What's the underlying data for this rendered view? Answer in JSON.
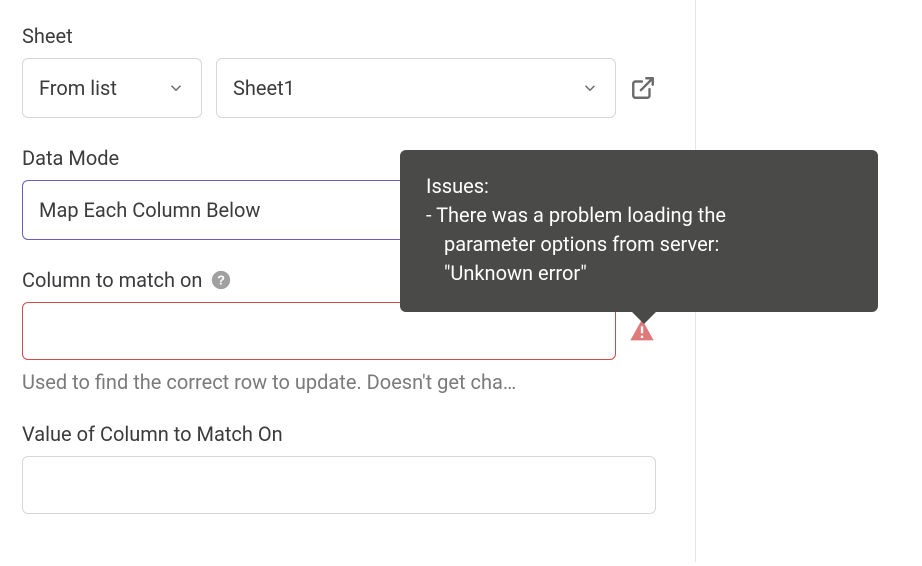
{
  "sheet": {
    "label": "Sheet",
    "source_select_value": "From list",
    "sheet_select_value": "Sheet1"
  },
  "data_mode": {
    "label": "Data Mode",
    "value": "Map Each Column Below"
  },
  "column_match": {
    "label": "Column to match on",
    "value": "",
    "helper": "Used to find the correct row to update. Doesn't get cha…"
  },
  "value_column": {
    "label": "Value of Column to Match On",
    "value": ""
  },
  "tooltip": {
    "title": "Issues:",
    "line1": " - There was a problem loading the",
    "line2": "parameter options from server:",
    "line3": "\"Unknown error\""
  }
}
